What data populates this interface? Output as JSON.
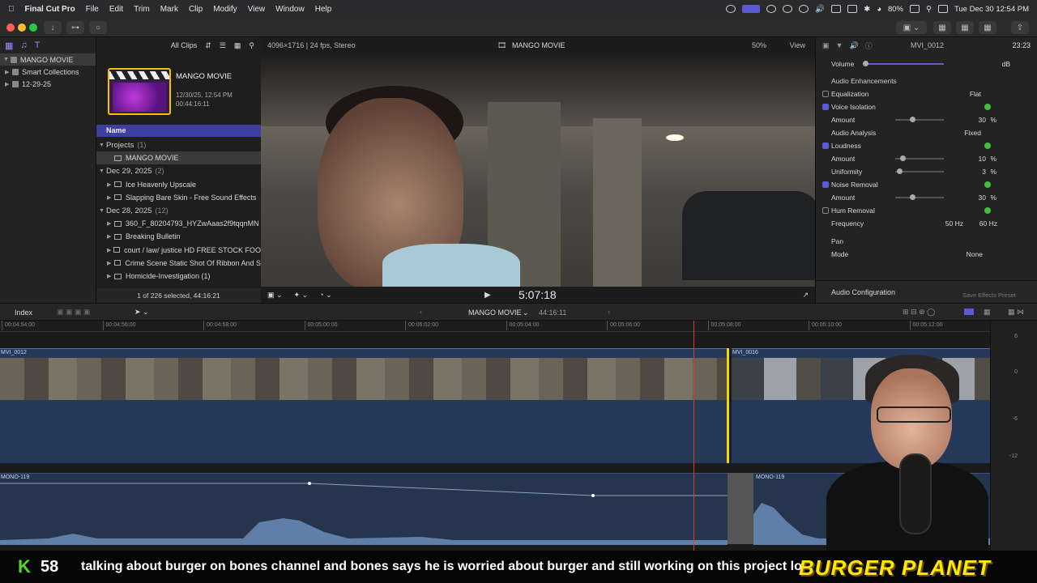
{
  "menubar": {
    "app": "Final Cut Pro",
    "items": [
      "File",
      "Edit",
      "Trim",
      "Mark",
      "Clip",
      "Modify",
      "View",
      "Window",
      "Help"
    ],
    "battery": "80%",
    "datetime": "Tue Dec 30  12:54 PM"
  },
  "library": {
    "items": [
      {
        "label": "MANGO MOVIE"
      },
      {
        "label": "Smart Collections"
      },
      {
        "label": "12-29-25"
      }
    ]
  },
  "browser": {
    "filter": "All Clips",
    "project_title": "MANGO MOVIE",
    "project_date": "12/30/25, 12:54 PM",
    "project_duration": "00:44:16:11",
    "column_name": "Name",
    "rows": [
      {
        "kind": "group",
        "label": "Projects",
        "count": "(1)"
      },
      {
        "kind": "clip",
        "label": "MANGO MOVIE"
      },
      {
        "kind": "group",
        "label": "Dec 29, 2025",
        "count": "(2)"
      },
      {
        "kind": "clip",
        "label": "Ice Heavenly Upscale"
      },
      {
        "kind": "clip",
        "label": "Slapping Bare Skin - Free Sound Effects"
      },
      {
        "kind": "group",
        "label": "Dec 28, 2025",
        "count": "(12)"
      },
      {
        "kind": "clip",
        "label": "360_F_80204793_HYZwAaas2f9tqqnMN"
      },
      {
        "kind": "clip",
        "label": "Breaking Bulletin"
      },
      {
        "kind": "clip",
        "label": "court / law/ justice HD FREE STOCK FOO"
      },
      {
        "kind": "clip",
        "label": "Crime Scene Static Shot Of Ribbon And S"
      },
      {
        "kind": "clip",
        "label": "Homicide-Investigation (1)"
      }
    ],
    "footer": "1 of 226 selected, 44:16:21"
  },
  "viewer": {
    "format": "4096×1716 | 24 fps, Stereo",
    "title": "MANGO MOVIE",
    "zoom": "50%",
    "view_menu": "View",
    "timecode": "5:07:18"
  },
  "inspector": {
    "clip_name": "MVI_0012",
    "clip_duration": "23:23",
    "volume_label": "Volume",
    "volume_unit": "dB",
    "enhancements_title": "Audio Enhancements",
    "rows": [
      {
        "label": "Equalization",
        "value": "Flat",
        "check": false
      },
      {
        "label": "Voice Isolation",
        "check": true
      },
      {
        "label": "Amount",
        "value": "30",
        "unit": "%",
        "level": 0.3
      },
      {
        "label": "Audio Analysis",
        "value": "Fixed"
      },
      {
        "label": "Loudness",
        "check": true
      },
      {
        "label": "Amount",
        "value": "10",
        "unit": "%",
        "level": 0.1
      },
      {
        "label": "Uniformity",
        "value": "3",
        "unit": "%",
        "level": 0.03
      },
      {
        "label": "Noise Removal",
        "check": true
      },
      {
        "label": "Amount",
        "value": "30",
        "unit": "%",
        "level": 0.3
      },
      {
        "label": "Hum Removal",
        "check": false
      },
      {
        "label": "Frequency",
        "value": "50 Hz",
        "value2": "60 Hz"
      }
    ],
    "pan_title": "Pan",
    "mode_label": "Mode",
    "mode_value": "None",
    "audio_config": "Audio Configuration",
    "save_preset": "Save Effects Preset"
  },
  "timeline": {
    "index_label": "Index",
    "project": "MANGO MOVIE",
    "duration": "44:16:11",
    "ruler": [
      "00:04:54:00",
      "00:04:56:00",
      "00:04:58:00",
      "00:05:00:00",
      "00:05:02:00",
      "00:05:04:00",
      "00:05:06:00",
      "00:05:08:00",
      "00:05:10:00",
      "00:05:12:00"
    ],
    "video_clips": [
      "MVI_0012",
      "MVI_0016"
    ],
    "audio_clips": [
      "MONO-119",
      "MONO-119"
    ],
    "meter_ticks": [
      "6",
      "0",
      "-6",
      "-12"
    ]
  },
  "overlay": {
    "k_label": "K",
    "k_count": "58",
    "ticker": "talking about burger on bones channel and bones says he is worried about burger and still working on this project lol",
    "brand": "BURGER PLANET"
  },
  "colors": {
    "accent": "#5b5bd6",
    "playhead": "#e23a2c",
    "skimmer": "#f2d700",
    "check": "#3cc23c"
  }
}
